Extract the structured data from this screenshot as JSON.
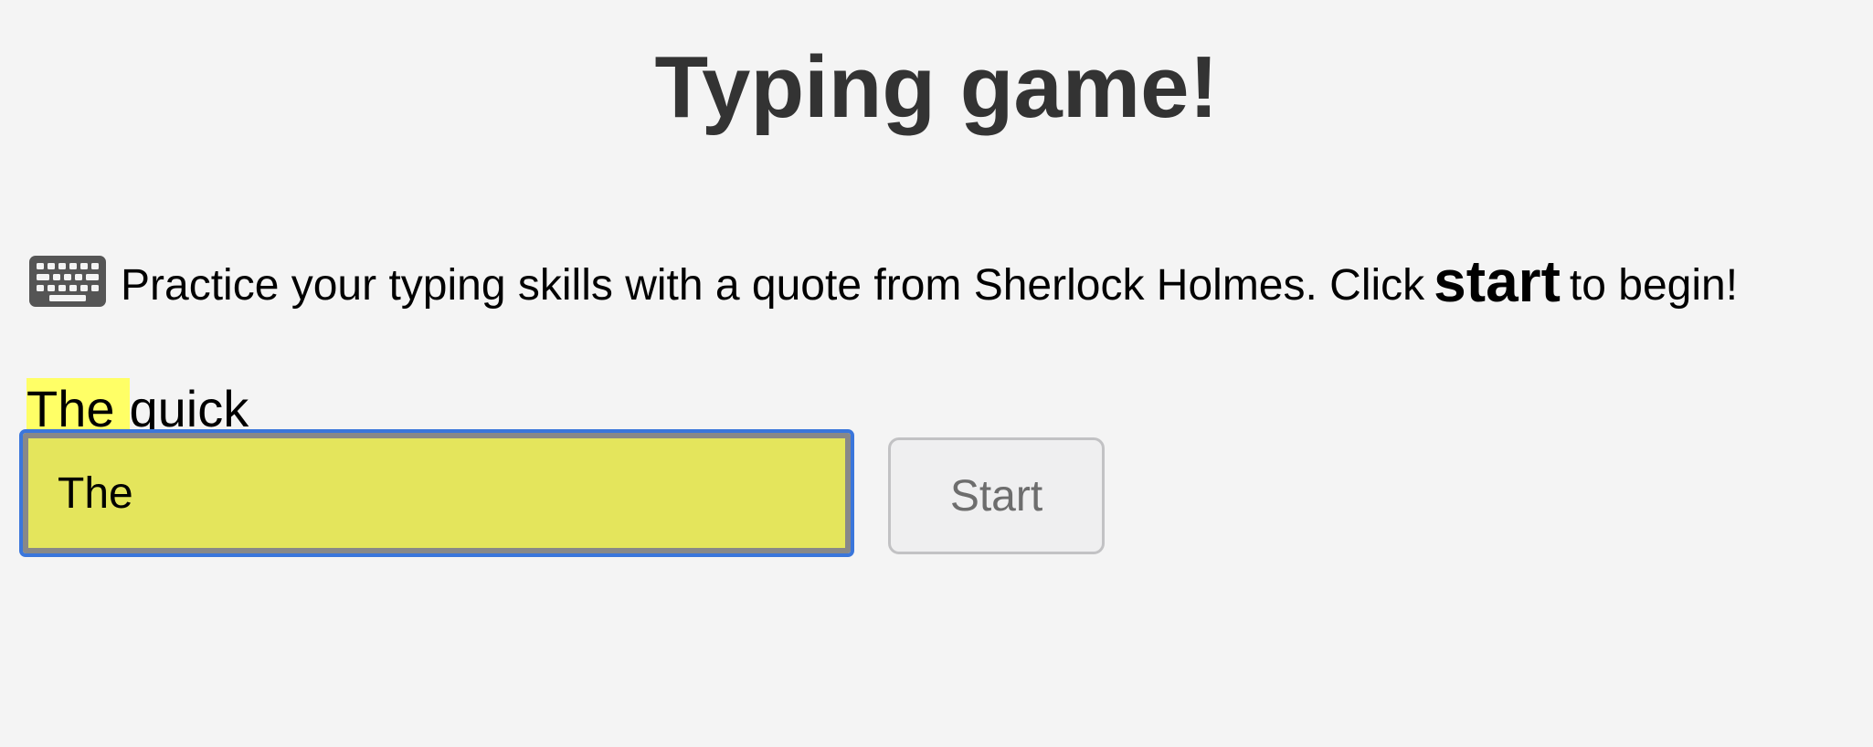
{
  "page": {
    "title": "Typing game!"
  },
  "instructions": {
    "icon": "keyboard-icon",
    "text_before": "Practice your typing skills with a quote from Sherlock Holmes. Click",
    "emphasis": "start",
    "text_after": "to begin!"
  },
  "quote": {
    "words": [
      "The",
      "quick"
    ],
    "current_word_index": 0
  },
  "typing_input": {
    "value": "The"
  },
  "start_button": {
    "label": "Start",
    "disabled": true
  },
  "colors": {
    "background": "#f4f4f4",
    "title": "#333333",
    "word_highlight": "#ffff66",
    "input_background": "#e4e55c",
    "input_focus_ring": "#3a76db",
    "button_background": "#efeff0",
    "button_text": "#6d6d6d"
  }
}
